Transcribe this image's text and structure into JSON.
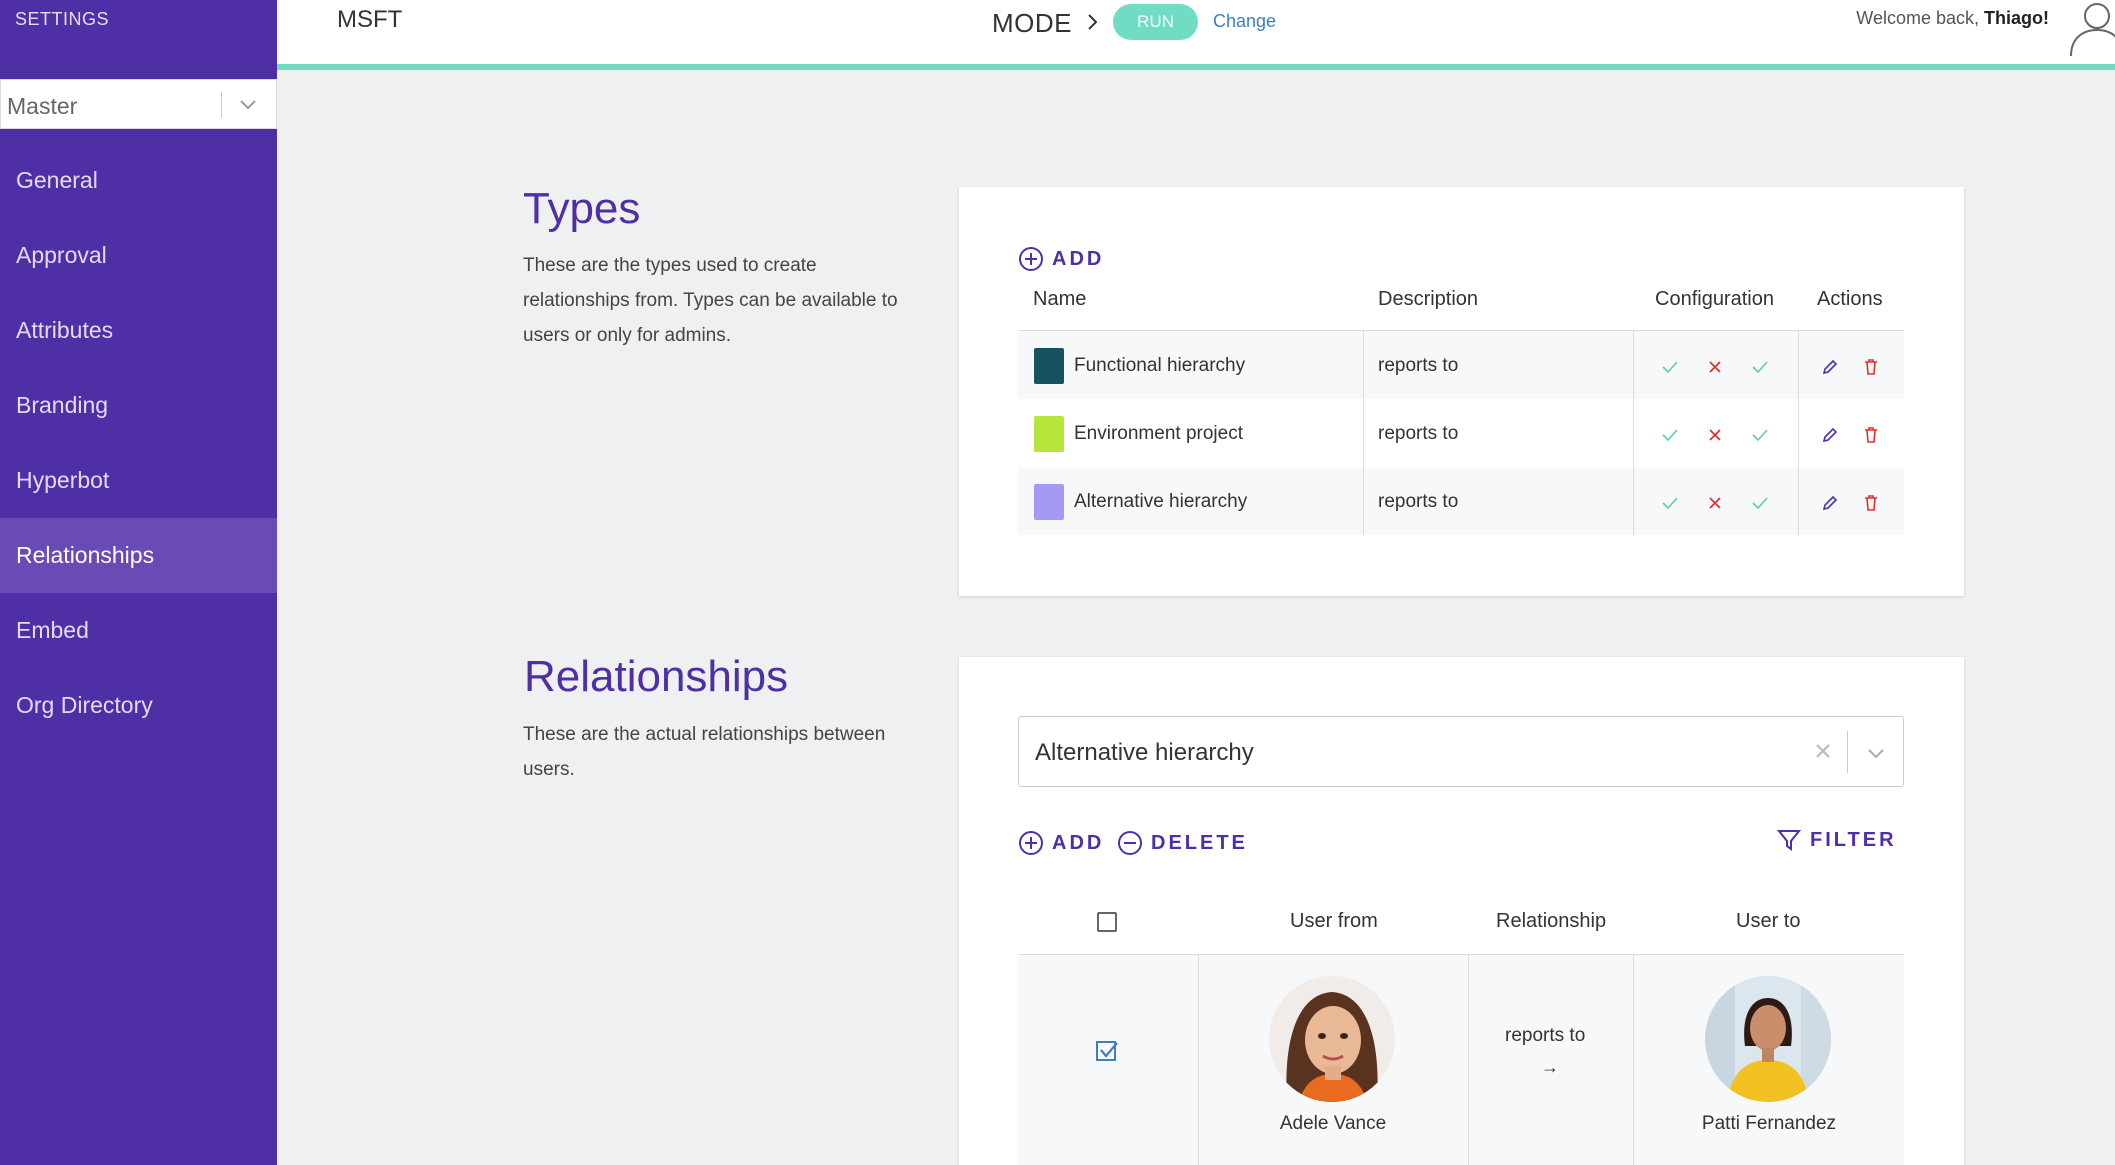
{
  "sidebar": {
    "settings_label": "SETTINGS",
    "environment_value": "Master",
    "items": [
      {
        "label": "General"
      },
      {
        "label": "Approval"
      },
      {
        "label": "Attributes"
      },
      {
        "label": "Branding"
      },
      {
        "label": "Hyperbot"
      },
      {
        "label": "Relationships",
        "active": true
      },
      {
        "label": "Embed"
      },
      {
        "label": "Org Directory"
      }
    ]
  },
  "header": {
    "brand": "MSFT",
    "mode_label": "MODE",
    "mode_value": "RUN",
    "change_label": "Change",
    "welcome_prefix": "Welcome back, ",
    "user_name": "Thiago!"
  },
  "types_section": {
    "title": "Types",
    "description": "These are the types used to create relationships from. Types can be available to users or only for admins.",
    "add_label": "ADD",
    "columns": {
      "name": "Name",
      "description": "Description",
      "configuration": "Configuration",
      "actions": "Actions"
    },
    "rows": [
      {
        "name": "Functional hierarchy",
        "description": "reports to",
        "color": "#17525f"
      },
      {
        "name": "Environment project",
        "description": "reports to",
        "color": "#b7e63a"
      },
      {
        "name": "Alternative hierarchy",
        "description": "reports to",
        "color": "#a59af3"
      }
    ]
  },
  "relationships_section": {
    "title": "Relationships",
    "description": "These are the actual relationships between users.",
    "selected_type": "Alternative hierarchy",
    "add_label": "ADD",
    "delete_label": "DELETE",
    "filter_label": "FILTER",
    "columns": {
      "user_from": "User from",
      "relationship": "Relationship",
      "user_to": "User to"
    },
    "rows": [
      {
        "user_from": "Adele Vance",
        "relationship": "reports to",
        "arrow": "→",
        "user_to": "Patti Fernandez",
        "checked": true
      }
    ]
  },
  "colors": {
    "accent": "#4f2fa6",
    "teal": "#71dcc4",
    "check_green": "#5ccfa8",
    "x_red": "#e03131"
  }
}
